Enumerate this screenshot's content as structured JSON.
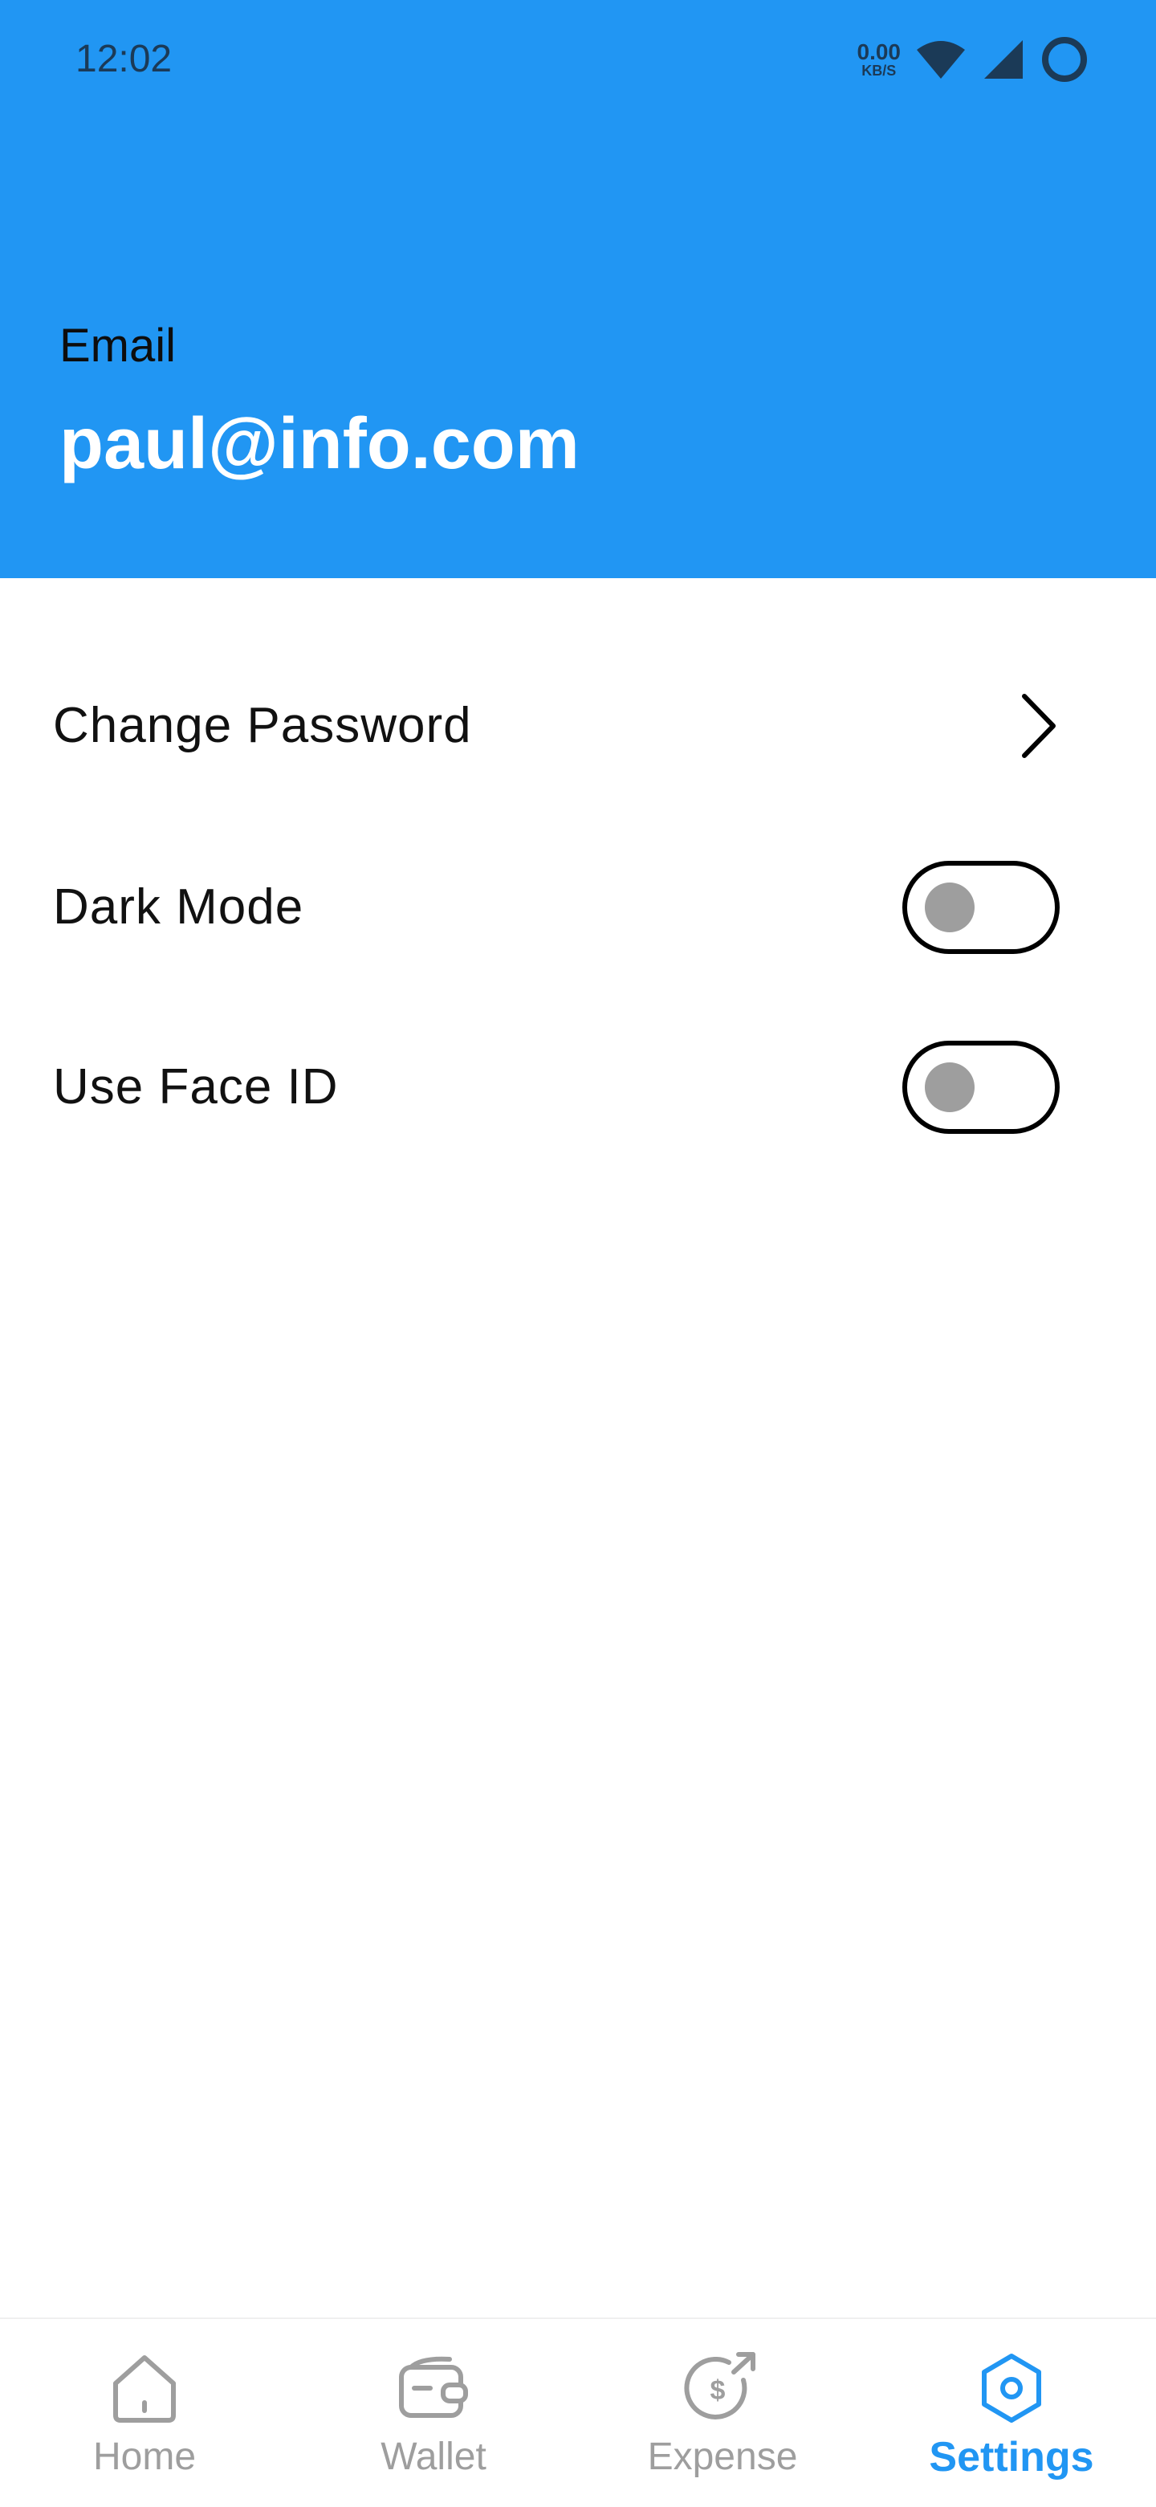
{
  "status_bar": {
    "time": "12:02",
    "net_speed_value": "0.00",
    "net_speed_unit": "KB/S",
    "icons": [
      "wifi-icon",
      "signal-icon",
      "battery-ring-icon"
    ]
  },
  "profile": {
    "email_label": "Email",
    "email_value": "paul@info.com"
  },
  "settings": {
    "change_password_label": "Change Password",
    "dark_mode_label": "Dark Mode",
    "dark_mode_on": false,
    "face_id_label": "Use Face ID",
    "face_id_on": false
  },
  "bottom_nav": {
    "home_label": "Home",
    "wallet_label": "Wallet",
    "expense_label": "Expense",
    "settings_label": "Settings",
    "active": "Settings"
  },
  "colors": {
    "primary": "#2196F3",
    "inactive": "#9E9E9E",
    "header_text_dark": "#1B3A57"
  }
}
